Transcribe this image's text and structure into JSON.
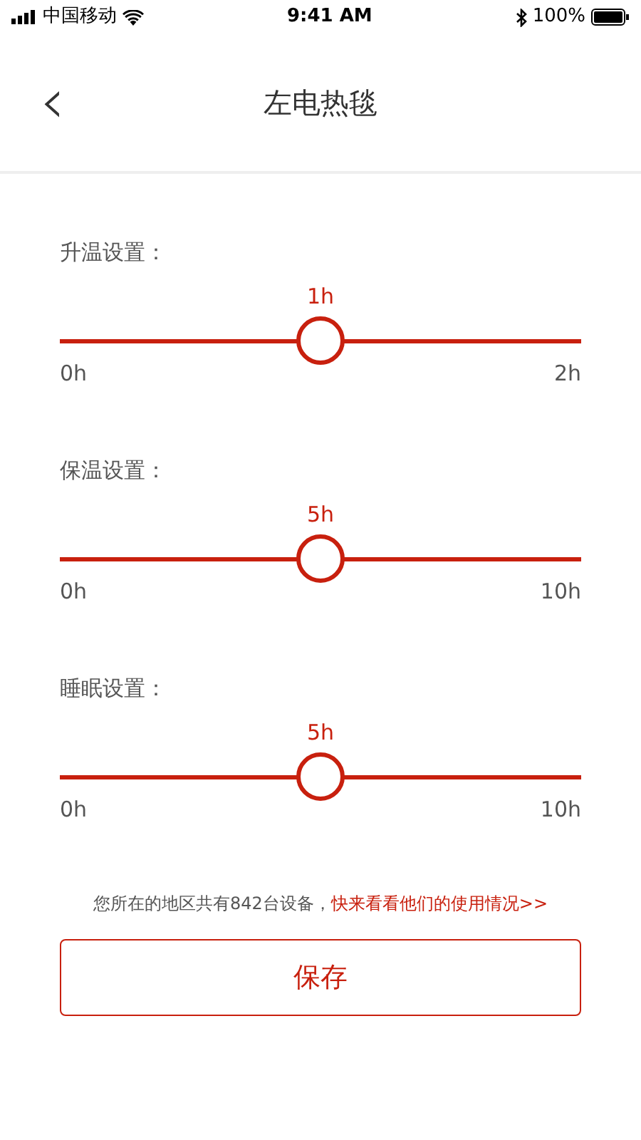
{
  "status_bar": {
    "carrier": "中国移动",
    "time": "9:41 AM",
    "battery": "100%"
  },
  "nav": {
    "back": "‹",
    "title": "左电热毯"
  },
  "sliders": [
    {
      "label": "升温设置：",
      "value": "1h",
      "min": "0h",
      "max": "2h",
      "level": 0.5
    },
    {
      "label": "保温设置：",
      "value": "5h",
      "min": "0h",
      "max": "10h",
      "level": 0.5
    },
    {
      "label": "睡眠设置：",
      "value": "5h",
      "min": "0h",
      "max": "10h",
      "level": 0.5
    }
  ],
  "footer": {
    "text": "您所在的地区共有842台设备，",
    "link": "快来看看他们的使用情况>>"
  },
  "save_button": "保存"
}
